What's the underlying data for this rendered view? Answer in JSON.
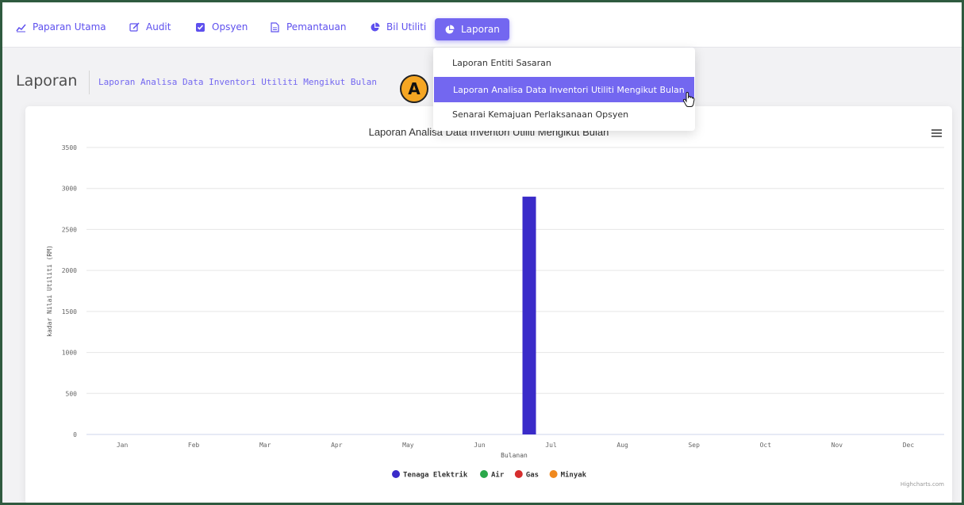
{
  "nav": {
    "items": [
      {
        "label": "Paparan Utama",
        "icon": "line-chart-icon"
      },
      {
        "label": "Audit",
        "icon": "edit-icon"
      },
      {
        "label": "Opsyen",
        "icon": "check-square-icon"
      },
      {
        "label": "Pemantauan",
        "icon": "file-icon"
      },
      {
        "label": "Bil Utiliti",
        "icon": "pie-chart-icon"
      },
      {
        "label": "Laporan",
        "icon": "pie-chart-icon",
        "active": true
      }
    ]
  },
  "dropdown": {
    "items": [
      {
        "label": "Laporan Entiti Sasaran"
      },
      {
        "label": "Laporan Analisa Data Inventori Utiliti Mengikut Bulan",
        "active": true
      },
      {
        "label": "Senarai Kemajuan Perlaksanaan Opsyen"
      }
    ]
  },
  "page": {
    "title": "Laporan",
    "breadcrumb": "Laporan Analisa Data Inventori Utiliti Mengikut Bulan"
  },
  "marker": {
    "label": "A"
  },
  "chart_data": {
    "type": "bar",
    "title": "Laporan Analisa Data Inventori Utiliti Mengikut Bulan",
    "xlabel": "Bulanan",
    "ylabel": "kadar Nilai Utiliti (RM)",
    "ylim": [
      0,
      3500
    ],
    "yticks": [
      0,
      500,
      1000,
      1500,
      2000,
      2500,
      3000,
      3500
    ],
    "grid": true,
    "legend_position": "bottom",
    "categories": [
      "Jan",
      "Feb",
      "Mar",
      "Apr",
      "May",
      "Jun",
      "Jul",
      "Aug",
      "Sep",
      "Oct",
      "Nov",
      "Dec"
    ],
    "series": [
      {
        "name": "Tenaga Elektrik",
        "color": "#3a2bc9",
        "values": [
          0,
          0,
          0,
          0,
          0,
          0,
          2900,
          0,
          0,
          0,
          0,
          0
        ]
      },
      {
        "name": "Air",
        "color": "#2aa84a",
        "values": [
          0,
          0,
          0,
          0,
          0,
          0,
          0,
          0,
          0,
          0,
          0,
          0
        ]
      },
      {
        "name": "Gas",
        "color": "#d62e2e",
        "values": [
          0,
          0,
          0,
          0,
          0,
          0,
          0,
          0,
          0,
          0,
          0,
          0
        ]
      },
      {
        "name": "Minyak",
        "color": "#f0891e",
        "values": [
          0,
          0,
          0,
          0,
          0,
          0,
          0,
          0,
          0,
          0,
          0,
          0
        ]
      }
    ],
    "credits": "Highcharts.com"
  },
  "colors": {
    "accent": "#7367f0"
  }
}
